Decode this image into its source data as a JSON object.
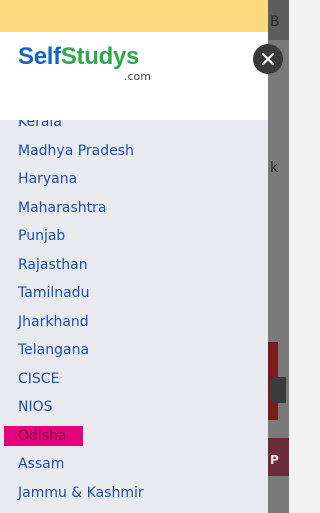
{
  "brand": {
    "name_part1": "Self",
    "name_part2": "Studys",
    "domain_suffix": ".com"
  },
  "menu": {
    "items": [
      {
        "label": "Kerala"
      },
      {
        "label": "Madhya Pradesh"
      },
      {
        "label": "Haryana"
      },
      {
        "label": "Maharashtra"
      },
      {
        "label": "Punjab"
      },
      {
        "label": "Rajasthan"
      },
      {
        "label": "Tamilnadu"
      },
      {
        "label": "Jharkhand"
      },
      {
        "label": "Telangana"
      },
      {
        "label": "CISCE"
      },
      {
        "label": "NIOS"
      },
      {
        "label": "Odisha"
      },
      {
        "label": "Assam"
      },
      {
        "label": "Jammu & Kashmir"
      }
    ],
    "active_label": "Odisha"
  },
  "background": {
    "fragment_b": "B",
    "fragment_k": "k",
    "fragment_p": "P"
  },
  "colors": {
    "top_bar": "#fbdb7b",
    "link": "#1d4fa8",
    "active_highlight": "#e6007e",
    "logo_blue": "#1565c0",
    "logo_green": "#2ea84d"
  },
  "icons": {
    "close": "close-icon"
  }
}
